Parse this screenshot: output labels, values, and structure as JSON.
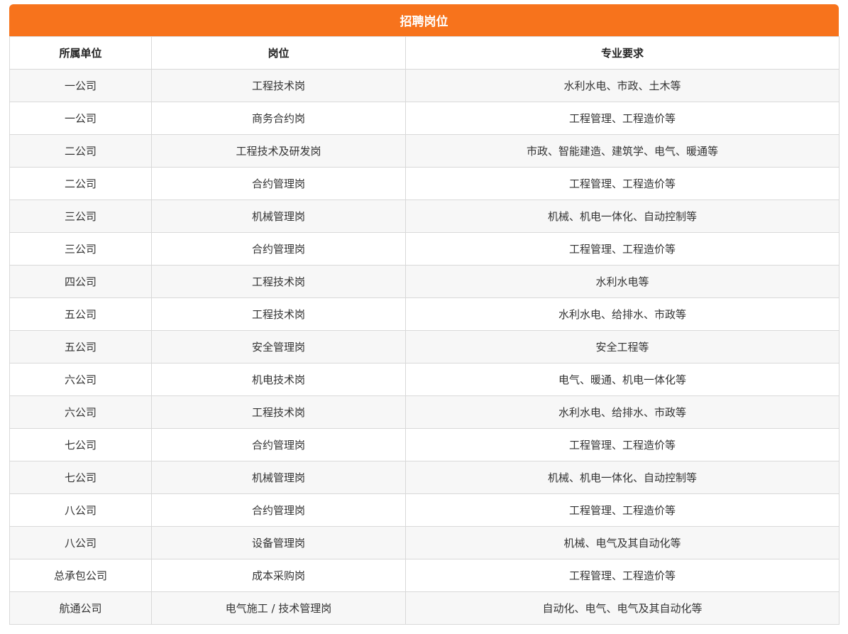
{
  "table": {
    "title": "招聘岗位",
    "headers": [
      "所属单位",
      "岗位",
      "专业要求"
    ],
    "rows": [
      [
        "一公司",
        "工程技术岗",
        "水利水电、市政、土木等"
      ],
      [
        "一公司",
        "商务合约岗",
        "工程管理、工程造价等"
      ],
      [
        "二公司",
        "工程技术及研发岗",
        "市政、智能建造、建筑学、电气、暖通等"
      ],
      [
        "二公司",
        "合约管理岗",
        "工程管理、工程造价等"
      ],
      [
        "三公司",
        "机械管理岗",
        "机械、机电一体化、自动控制等"
      ],
      [
        "三公司",
        "合约管理岗",
        "工程管理、工程造价等"
      ],
      [
        "四公司",
        "工程技术岗",
        "水利水电等"
      ],
      [
        "五公司",
        "工程技术岗",
        "水利水电、给排水、市政等"
      ],
      [
        "五公司",
        "安全管理岗",
        "安全工程等"
      ],
      [
        "六公司",
        "机电技术岗",
        "电气、暖通、机电一体化等"
      ],
      [
        "六公司",
        "工程技术岗",
        "水利水电、给排水、市政等"
      ],
      [
        "七公司",
        "合约管理岗",
        "工程管理、工程造价等"
      ],
      [
        "七公司",
        "机械管理岗",
        "机械、机电一体化、自动控制等"
      ],
      [
        "八公司",
        "合约管理岗",
        "工程管理、工程造价等"
      ],
      [
        "八公司",
        "设备管理岗",
        "机械、电气及其自动化等"
      ],
      [
        "总承包公司",
        "成本采购岗",
        "工程管理、工程造价等"
      ],
      [
        "航通公司",
        "电气施工 / 技术管理岗",
        "自动化、电气、电气及其自动化等"
      ]
    ]
  },
  "colors": {
    "header_bg": "#f7731c",
    "stripe": "#f7f7f7",
    "border": "#d9d9d9"
  }
}
